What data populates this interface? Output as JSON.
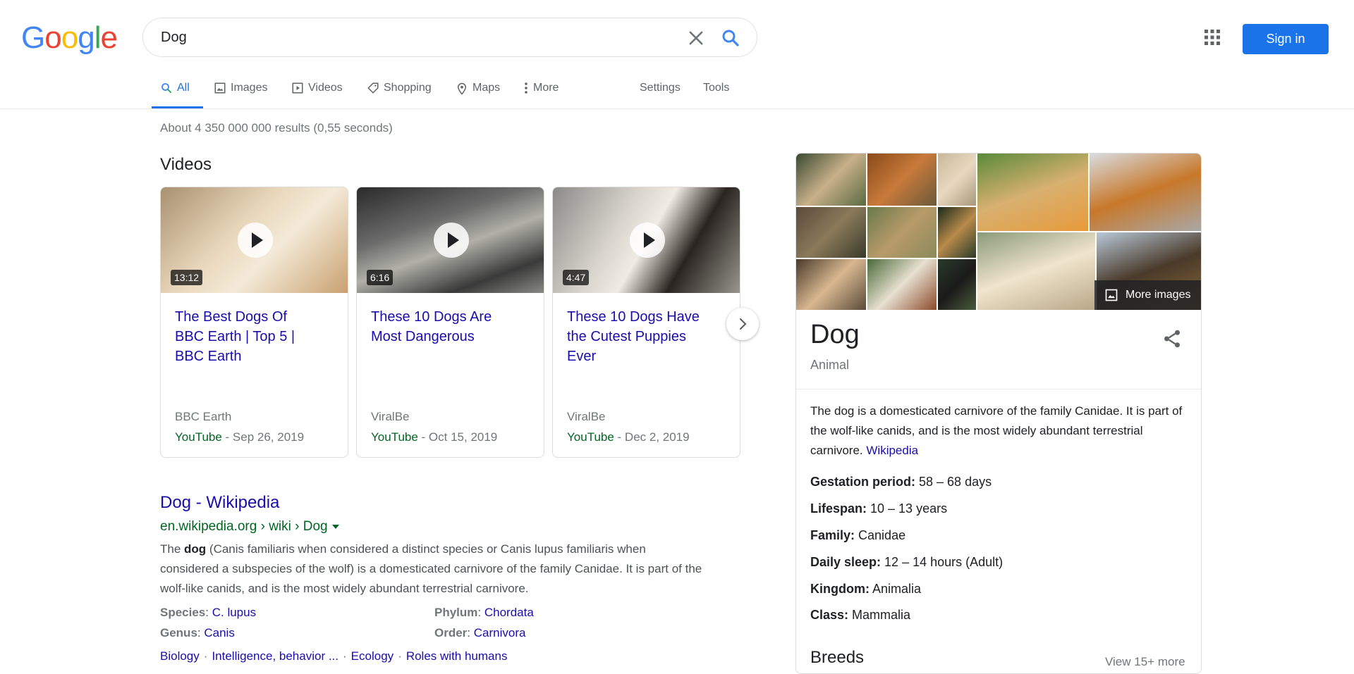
{
  "header": {
    "logo_text": "Google",
    "search_value": "Dog",
    "signin_label": "Sign in"
  },
  "tabs": {
    "all": "All",
    "images": "Images",
    "videos": "Videos",
    "shopping": "Shopping",
    "maps": "Maps",
    "more": "More",
    "settings": "Settings",
    "tools": "Tools"
  },
  "stats": "About 4 350 000 000 results (0,55 seconds)",
  "videos": {
    "heading": "Videos",
    "items": [
      {
        "title": "The Best Dogs Of BBC Earth | Top 5 | BBC Earth",
        "duration": "13:12",
        "source": "BBC Earth",
        "platform": "YouTube",
        "date": "Sep 26, 2019"
      },
      {
        "title": "These 10 Dogs Are Most Dangerous",
        "duration": "6:16",
        "source": "ViralBe",
        "platform": "YouTube",
        "date": "Oct 15, 2019"
      },
      {
        "title": "These 10 Dogs Have the Cutest Puppies Ever",
        "duration": "4:47",
        "source": "ViralBe",
        "platform": "YouTube",
        "date": "Dec 2, 2019"
      }
    ],
    "date_sep": " - "
  },
  "result": {
    "title": "Dog - Wikipedia",
    "url": "en.wikipedia.org › wiki › Dog",
    "snippet_pre": "The ",
    "snippet_bold": "dog",
    "snippet_post": " (Canis familiaris when considered a distinct species or Canis lupus familiaris when considered a subspecies of the wolf) is a domesticated carnivore of the family Canidae. It is part of the wolf-like canids, and is the most widely abundant terrestrial carnivore.",
    "facts": [
      {
        "label": "Species",
        "value": "C. lupus"
      },
      {
        "label": "Genus",
        "value": "Canis"
      },
      {
        "label": "Phylum",
        "value": "Chordata"
      },
      {
        "label": "Order",
        "value": "Carnivora"
      }
    ],
    "fact_sep": ": ",
    "links": [
      "Biology",
      "Intelligence, behavior ...",
      "Ecology",
      "Roles with humans"
    ],
    "link_sep": "·"
  },
  "knowledge_panel": {
    "more_images": "More images",
    "title": "Dog",
    "subtitle": "Animal",
    "description": "The dog is a domesticated carnivore of the family Canidae. It is part of the wolf-like canids, and is the most widely abundant terrestrial carnivore. ",
    "description_link": "Wikipedia",
    "facts": [
      {
        "label": "Gestation period:",
        "value": " 58 – 68 days"
      },
      {
        "label": "Lifespan:",
        "value": " 10 – 13 years"
      },
      {
        "label": "Family:",
        "value": " Canidae"
      },
      {
        "label": "Daily sleep:",
        "value": " 12 – 14 hours (Adult)"
      },
      {
        "label": "Kingdom:",
        "value": " Animalia"
      },
      {
        "label": "Class:",
        "value": " Mammalia"
      }
    ],
    "breeds_heading": "Breeds",
    "breeds_more": "View 15+ more"
  },
  "colors": {
    "link": "#1a0dab",
    "url_green": "#006621",
    "accent_blue": "#1a73e8",
    "muted": "#70757a"
  }
}
